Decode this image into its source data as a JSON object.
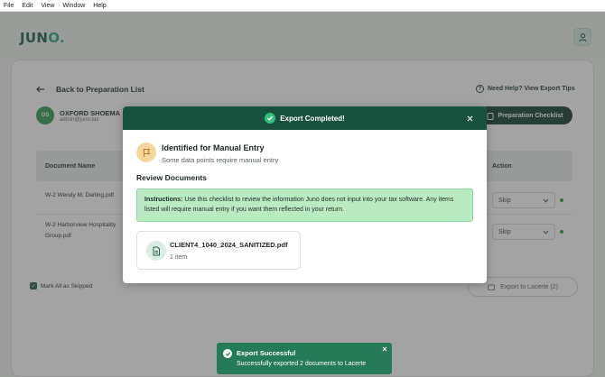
{
  "menubar": {
    "items": [
      "File",
      "Edit",
      "View",
      "Window",
      "Help"
    ]
  },
  "app": {
    "logo_text": "JUN",
    "logo_accent": "O.",
    "profile_icon": "person-icon"
  },
  "page": {
    "back_label": "Back to Preparation List",
    "help_label": "Need Help? View Export Tips",
    "client": {
      "initials": "OS",
      "name": "OXFORD SHOEMA",
      "email": "admin@juno.tax"
    },
    "prep_checklist_label": "Preparation Checklist",
    "table": {
      "col_document": "Document Name",
      "col_action": "Action",
      "rows": [
        {
          "name": "W-2 Wendy M. Darling.pdf",
          "action": "Skip"
        },
        {
          "name": "W-2 Harborview Hospitality Group.pdf",
          "action": "Skip"
        }
      ]
    },
    "mark_all_label": "Mark All as Skipped",
    "export_button_label": "Export to Lacerte (2)"
  },
  "modal": {
    "header_title": "Export Completed!",
    "manual_entry_title": "Identified for Manual Entry",
    "manual_entry_subtitle": "Some data points require manual entry",
    "review_title": "Review Documents",
    "instructions_label": "Instructions:",
    "instructions_text": " Use this checklist to review the information Juno does not input into your tax software. Any items listed will require manual entry if you want them reflected in your return.",
    "document": {
      "name": "CLIENT4_1040_2024_SANITIZED.pdf",
      "count": "1 item"
    }
  },
  "toast": {
    "title": "Export Successful",
    "message": "Successfully exported 2 documents to Lacerte"
  },
  "colors": {
    "brand_dark": "#19513f",
    "success": "#35c07a",
    "instructions_bg": "#b9ebc3",
    "toast_bg": "#257a58",
    "flag_bg": "#f6d79b"
  }
}
